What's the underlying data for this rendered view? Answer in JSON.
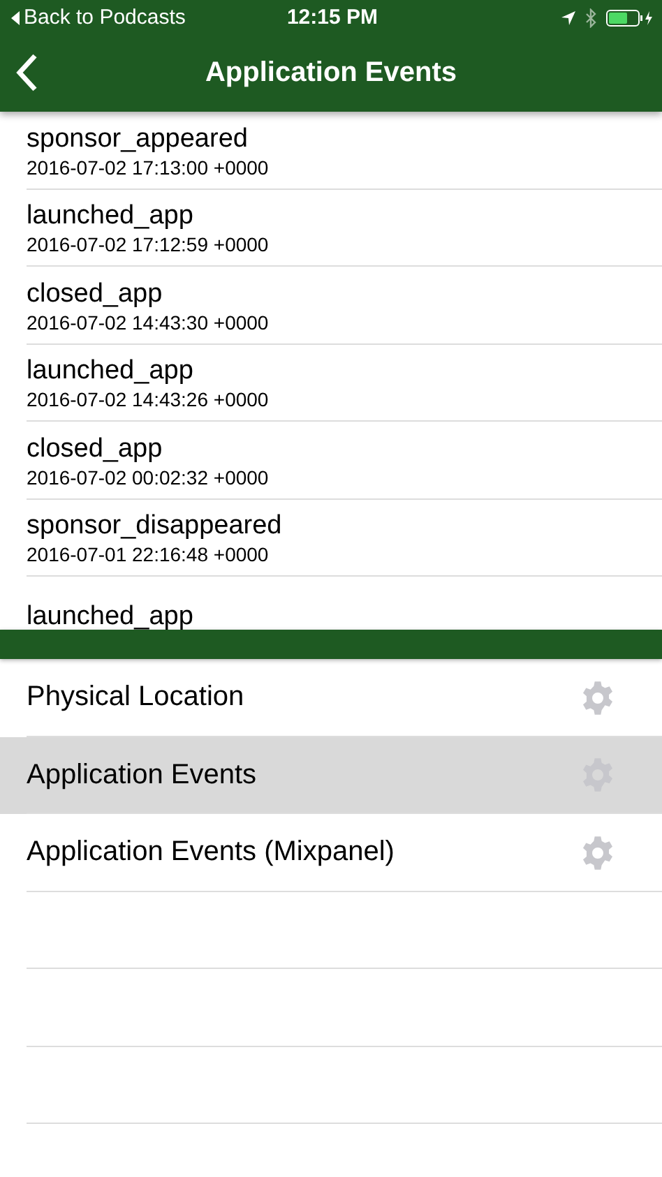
{
  "status_bar": {
    "back_label": "Back to Podcasts",
    "time": "12:15 PM"
  },
  "nav_bar": {
    "title": "Application Events"
  },
  "events": [
    {
      "name": "sponsor_appeared",
      "time": "2016-07-02 17:13:00 +0000"
    },
    {
      "name": "launched_app",
      "time": "2016-07-02 17:12:59 +0000"
    },
    {
      "name": "closed_app",
      "time": "2016-07-02 14:43:30 +0000"
    },
    {
      "name": "launched_app",
      "time": "2016-07-02 14:43:26 +0000"
    },
    {
      "name": "closed_app",
      "time": "2016-07-02 00:02:32 +0000"
    },
    {
      "name": "sponsor_disappeared",
      "time": "2016-07-01 22:16:48 +0000"
    },
    {
      "name": "launched_app"
    }
  ],
  "sources": [
    {
      "label": "Physical Location",
      "selected": false
    },
    {
      "label": "Application Events",
      "selected": true
    },
    {
      "label": "Application Events (Mixpanel)",
      "selected": false
    }
  ]
}
